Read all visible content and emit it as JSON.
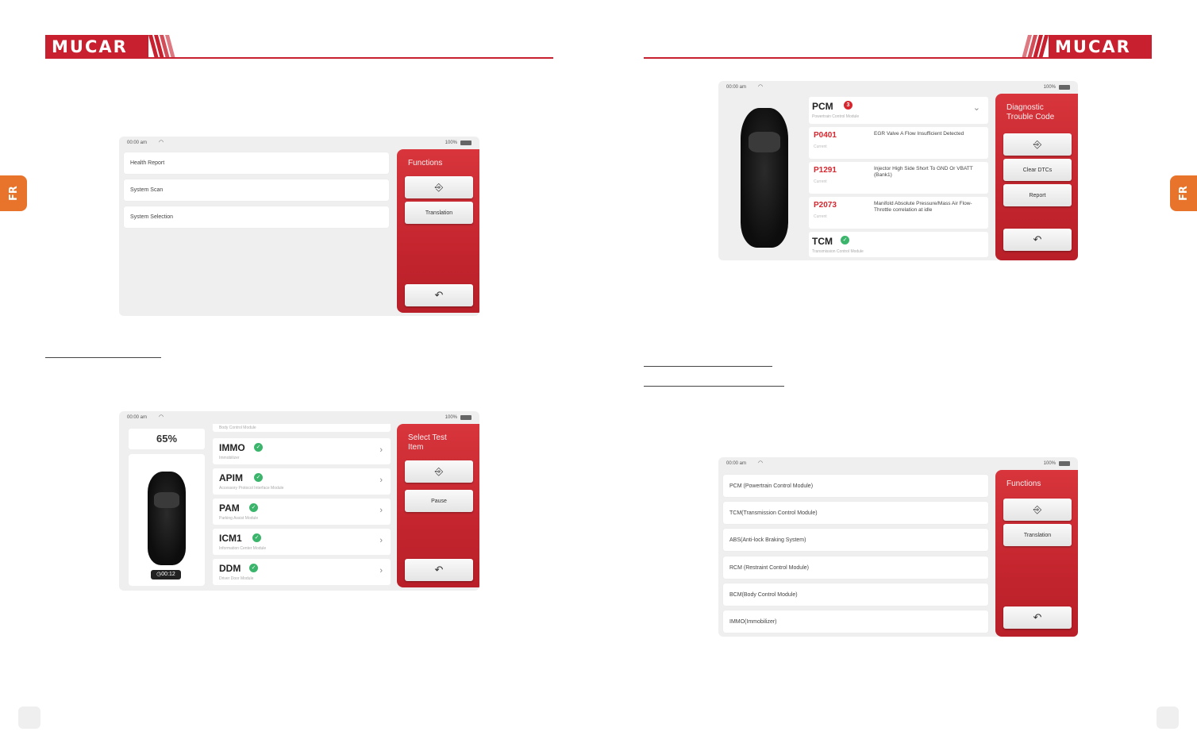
{
  "brand": {
    "logo_text": "MUCAR",
    "accent_color": "#c8202e"
  },
  "language_tab": "FR",
  "screens": {
    "functions_a": {
      "status": {
        "time": "00:00 am",
        "battery": "100%"
      },
      "menu": [
        "Health Report",
        "System Scan",
        "System Selection"
      ],
      "panel_title": "Functions",
      "buttons": {
        "exit_icon": "exit-icon",
        "translation": "Translation",
        "back_icon": "back-icon"
      }
    },
    "scan": {
      "status": {
        "time": "00:00 am",
        "battery": "100%"
      },
      "progress_text": "65%",
      "timer": "00:12",
      "top_partial": "Body Control Module",
      "modules": [
        {
          "name": "IMMO",
          "desc": "Immobilizer"
        },
        {
          "name": "APIM",
          "desc": "Accessory Protocol Interface Module"
        },
        {
          "name": "PAM",
          "desc": "Parking Assist Module"
        },
        {
          "name": "ICM1",
          "desc": "Information Center Module"
        },
        {
          "name": "DDM",
          "desc": "Driver Door Module"
        }
      ],
      "panel_title": "Select Test Item",
      "buttons": {
        "pause": "Pause"
      }
    },
    "dtc": {
      "status": {
        "time": "00:00 am",
        "battery": "100%"
      },
      "module": {
        "name": "PCM",
        "desc": "Powertrain Control Module",
        "count": "3"
      },
      "codes": [
        {
          "code": "P0401",
          "status": "Current",
          "text": "EGR Valve A Flow Insufficient Detected"
        },
        {
          "code": "P1291",
          "status": "Current",
          "text": "Injector High Side Short To GND Or VBATT (Bank1)"
        },
        {
          "code": "P2073",
          "status": "Current",
          "text": "Manifold Absolute Pressure/Mass Air Flow-Throttle correlation at idle"
        }
      ],
      "module2": {
        "name": "TCM",
        "desc": "Transmission Control Module"
      },
      "panel_title": "Diagnostic Trouble Code",
      "buttons": {
        "clear": "Clear DTCs",
        "report": "Report"
      }
    },
    "functions_b": {
      "status": {
        "time": "00:00 am",
        "battery": "100%"
      },
      "menu": [
        "PCM (Powertrain Control Module)",
        "TCM(Transmission Control Module)",
        "ABS(Anti-lock Braking System)",
        "RCM (Restraint Control Module)",
        "BCM(Body Control Module)",
        "IMMO(Immobilizer)"
      ],
      "panel_title": "Functions",
      "buttons": {
        "translation": "Translation"
      }
    }
  }
}
